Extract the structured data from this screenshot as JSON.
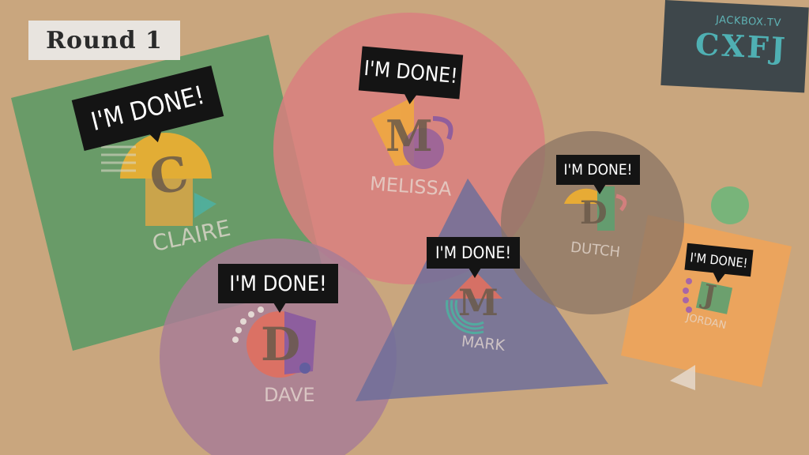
{
  "round": {
    "label": "Round 1"
  },
  "room": {
    "site": "JACKBOX.TV",
    "code": "CXFJ"
  },
  "players": [
    {
      "name": "CLAIRE",
      "initial": "C",
      "status": "I'M DONE!"
    },
    {
      "name": "MELISSA",
      "initial": "M",
      "status": "I'M DONE!"
    },
    {
      "name": "DUTCH",
      "initial": "D",
      "status": "I'M DONE!"
    },
    {
      "name": "DAVE",
      "initial": "D",
      "status": "I'M DONE!"
    },
    {
      "name": "MARK",
      "initial": "M",
      "status": "I'M DONE!"
    },
    {
      "name": "JORDAN",
      "initial": "J",
      "status": "I'M DONE!"
    }
  ],
  "colors": {
    "background": "#c9a67e",
    "claire_shape": "#5e9a66",
    "melissa_shape": "#d97f7f",
    "dutch_shape": "#8a7466",
    "dave_shape": "#a87c95",
    "mark_shape": "#6f6f9a",
    "jordan_shape": "#eea45a",
    "room_code": "#4fb0b3"
  }
}
